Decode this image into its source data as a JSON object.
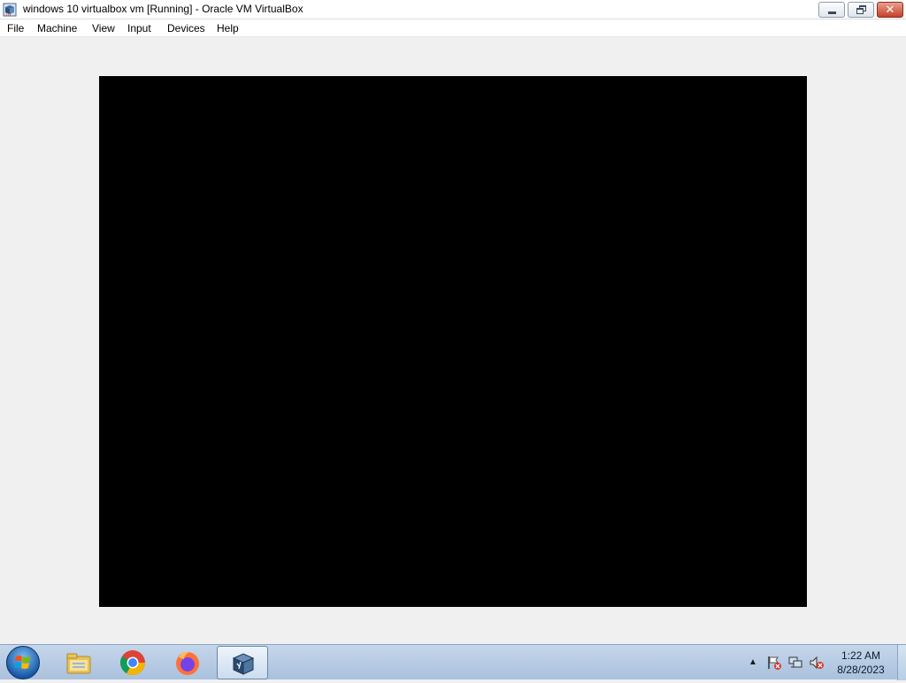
{
  "window": {
    "title": "windows 10 virtualbox vm [Running] - Oracle VM VirtualBox",
    "close_glyph": "✕"
  },
  "menubar": {
    "items": [
      {
        "label": "File"
      },
      {
        "label": "Machine"
      },
      {
        "label": "View"
      },
      {
        "label": "Input"
      },
      {
        "label": "Devices"
      },
      {
        "label": "Help"
      }
    ]
  },
  "vm_display": {
    "background": "#000000"
  },
  "taskbar": {
    "start_icon": "windows-start-orb-icon",
    "pinned": [
      {
        "icon": "file-explorer-icon"
      },
      {
        "icon": "chrome-icon"
      },
      {
        "icon": "firefox-icon"
      },
      {
        "icon": "virtualbox-icon",
        "active": true
      }
    ],
    "tray": {
      "overflow_glyph": "▲",
      "icons": [
        "action-center-flag-icon",
        "network-icon",
        "volume-muted-icon"
      ],
      "time": "1:22 AM",
      "date": "8/28/2023"
    }
  },
  "colors": {
    "taskbar": "#b8cde6",
    "window_bg": "#f0f0f0",
    "close_button": "#c7402a"
  }
}
